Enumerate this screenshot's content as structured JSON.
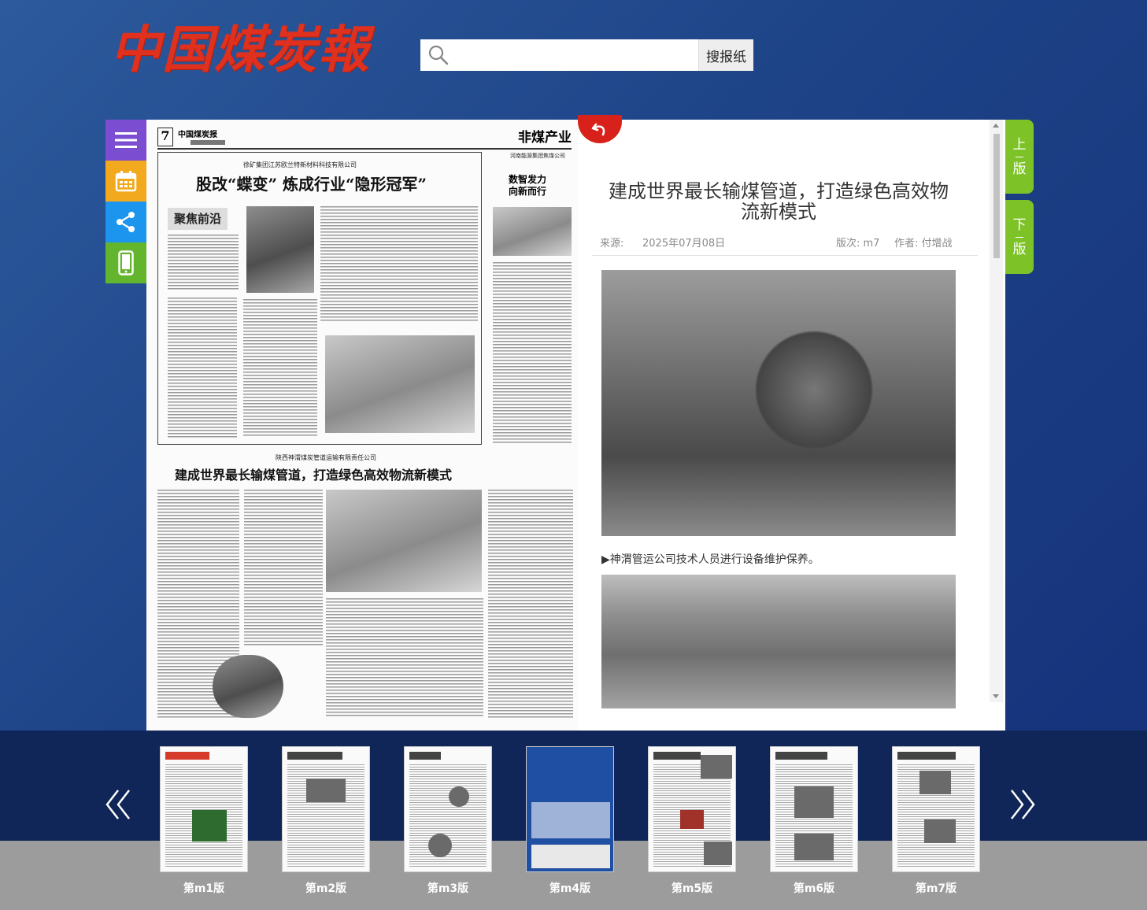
{
  "header": {
    "logo_text": "中国煤炭報",
    "search_placeholder": "",
    "search_button": "搜报纸"
  },
  "tools": {
    "menu_icon": "menu-icon",
    "calendar_icon": "calendar-icon",
    "share_icon": "share-icon",
    "mobile_icon": "mobile-icon",
    "colors": {
      "menu": "#7b4ed1",
      "calendar": "#f3a91d",
      "share": "#1c95ef",
      "mobile": "#63b52d"
    }
  },
  "newspaper": {
    "page_no": "7",
    "masthead": "中国煤炭报",
    "section": "非煤产业",
    "lead_kicker": "徐矿集团江苏欧兰特新材料科技有限公司",
    "lead_headline": "股改“蝶变” 炼成行业“隐形冠军”",
    "column_badge": "聚焦前沿",
    "side_kicker": "河南能源集团焦煤公司",
    "side_headline": "数智发力 向新而行",
    "second_kicker": "陕西神渭煤炭管道运输有限责任公司",
    "second_headline": "建成世界最长输煤管道，打造绿色高效物流新模式"
  },
  "article": {
    "title": "建成世界最长输煤管道，打造绿色高效物流新模式",
    "source_label": "来源:",
    "date": "2025年07月08日",
    "edition_label": "版次: m7",
    "author_label": "作者: 付增战",
    "caption": "▶神渭管运公司技术人员进行设备维护保养。"
  },
  "nav": {
    "prev_label_top": "上",
    "prev_label_bottom": "版",
    "next_label_top": "下",
    "next_label_bottom": "版",
    "accent": "#7dc328",
    "back_color": "#d8211a"
  },
  "thumbnails": [
    {
      "label": "第m1版"
    },
    {
      "label": "第m2版"
    },
    {
      "label": "第m3版"
    },
    {
      "label": "第m4版"
    },
    {
      "label": "第m5版"
    },
    {
      "label": "第m6版"
    },
    {
      "label": "第m7版"
    }
  ]
}
